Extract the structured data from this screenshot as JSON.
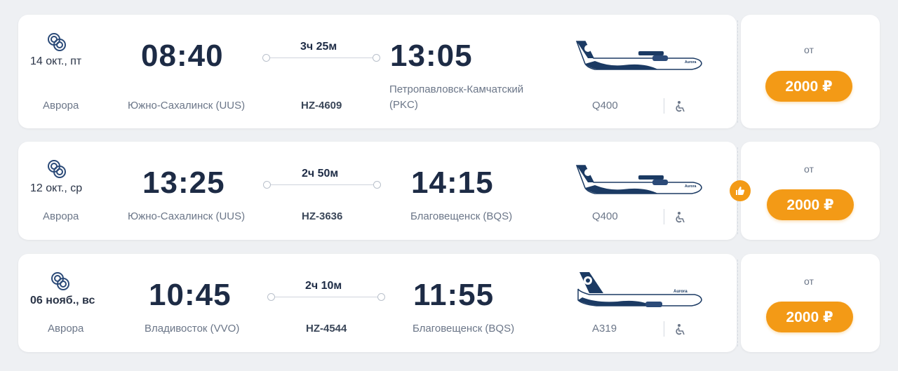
{
  "currency_prefix": "от",
  "flights": [
    {
      "date": "14 окт., пт",
      "airline": "Аврора",
      "dep_time": "08:40",
      "dep_city": "Южно-Сахалинск (UUS)",
      "duration": "3ч 25м",
      "flight_no": "HZ-4609",
      "arr_time": "13:05",
      "arr_city": "Петропавловск-Камчатский (PKC)",
      "aircraft": "Q400",
      "price_prefix": "от",
      "price": "2000 ₽"
    },
    {
      "date": "12 окт., ср",
      "airline": "Аврора",
      "dep_time": "13:25",
      "dep_city": "Южно-Сахалинск (UUS)",
      "duration": "2ч 50м",
      "flight_no": "HZ-3636",
      "arr_time": "14:15",
      "arr_city": "Благовещенск (BQS)",
      "aircraft": "Q400",
      "price_prefix": "от",
      "price": "2000 ₽",
      "badge_icon": "thumbs-up-icon"
    },
    {
      "date": "06 нояб., вс",
      "airline": "Аврора",
      "dep_time": "10:45",
      "dep_city": "Владивосток (VVO)",
      "duration": "2ч 10м",
      "flight_no": "HZ-4544",
      "arr_time": "11:55",
      "arr_city": "Благовещенск (BQS)",
      "aircraft": "А319",
      "price_prefix": "от",
      "price": "2000 ₽"
    }
  ],
  "colors": {
    "accent": "#f39a16",
    "text_dark": "#1d2b45",
    "text_muted": "#6b7688",
    "plane_navy": "#1b3a63"
  },
  "icons": [
    "aurora-logo-icon",
    "plane-image",
    "wheelchair-icon",
    "thumbs-up-icon"
  ]
}
